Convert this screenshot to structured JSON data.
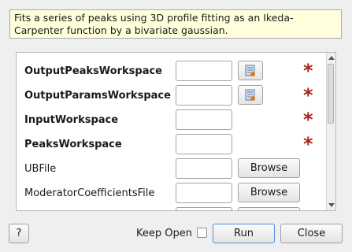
{
  "description": "Fits a series of peaks using 3D profile fitting as an Ikeda-Carpenter function by a bivariate gaussian.",
  "properties": [
    {
      "label": "OutputPeaksWorkspace",
      "bold": true,
      "value": "",
      "has_workspace_button": true,
      "has_browse": false,
      "required": true
    },
    {
      "label": "OutputParamsWorkspace",
      "bold": true,
      "value": "",
      "has_workspace_button": true,
      "has_browse": false,
      "required": true
    },
    {
      "label": "InputWorkspace",
      "bold": true,
      "value": "",
      "has_workspace_button": false,
      "has_browse": false,
      "required": true
    },
    {
      "label": "PeaksWorkspace",
      "bold": true,
      "value": "",
      "has_workspace_button": false,
      "has_browse": false,
      "required": true
    },
    {
      "label": "UBFile",
      "bold": false,
      "value": "",
      "has_workspace_button": false,
      "has_browse": true,
      "required": false
    },
    {
      "label": "ModeratorCoefficientsFile",
      "bold": false,
      "value": "",
      "has_workspace_button": false,
      "has_browse": true,
      "required": false
    }
  ],
  "browse_label": "Browse",
  "required_marker": "*",
  "footer": {
    "help_label": "?",
    "keep_open_label": "Keep Open",
    "keep_open_checked": false,
    "run_label": "Run",
    "close_label": "Close"
  },
  "colors": {
    "required_star": "#a8241c",
    "description_bg": "#ffffdc",
    "run_border": "#4a90d9"
  },
  "icons": {
    "workspace_button": "workspace-select-icon"
  }
}
